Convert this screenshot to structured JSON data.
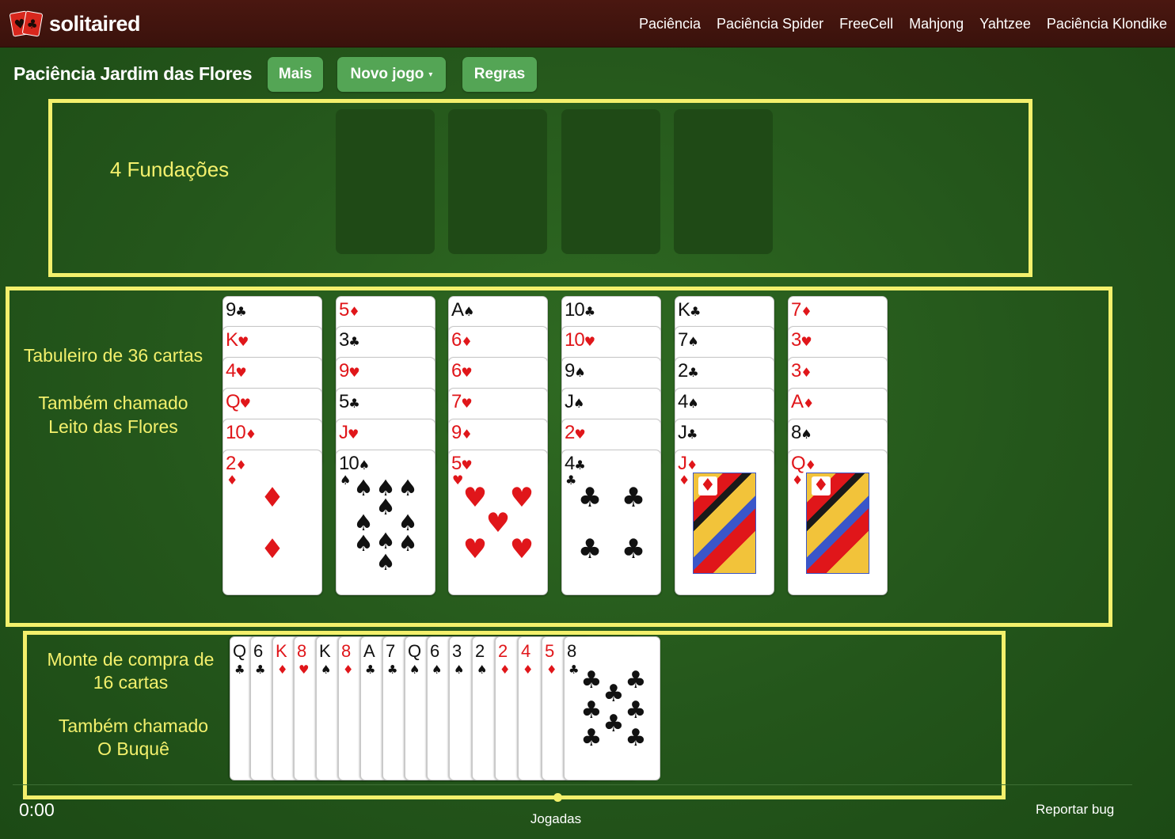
{
  "header": {
    "brand": "solitaired",
    "logo_suits": [
      "♥",
      "♣"
    ],
    "nav": [
      "Paciência",
      "Paciência Spider",
      "FreeCell",
      "Mahjong",
      "Yahtzee",
      "Paciência Klondike"
    ]
  },
  "toolbar": {
    "title": "Paciência Jardim das Flores",
    "more_label": "Mais",
    "new_game_label": "Novo jogo",
    "new_game_caret": "▾",
    "rules_label": "Regras"
  },
  "annotations": {
    "foundations": "4 Fundações",
    "tableau_title": "Tabuleiro de 36 cartas",
    "tableau_alias_1": "Também chamado",
    "tableau_alias_2": "Leito das Flores",
    "stock_title_1": "Monte de compra de",
    "stock_title_2": "16 cartas",
    "stock_alias_1": "Também chamado",
    "stock_alias_2": "O Buquê"
  },
  "foundations": [
    {},
    {},
    {},
    {}
  ],
  "tableau": [
    [
      {
        "rank": "9",
        "suit": "♣"
      },
      {
        "rank": "K",
        "suit": "♥"
      },
      {
        "rank": "4",
        "suit": "♥"
      },
      {
        "rank": "Q",
        "suit": "♥"
      },
      {
        "rank": "10",
        "suit": "♦"
      },
      {
        "rank": "2",
        "suit": "♦"
      }
    ],
    [
      {
        "rank": "5",
        "suit": "♦"
      },
      {
        "rank": "3",
        "suit": "♣"
      },
      {
        "rank": "9",
        "suit": "♥"
      },
      {
        "rank": "5",
        "suit": "♣"
      },
      {
        "rank": "J",
        "suit": "♥"
      },
      {
        "rank": "10",
        "suit": "♠"
      }
    ],
    [
      {
        "rank": "A",
        "suit": "♠"
      },
      {
        "rank": "6",
        "suit": "♦"
      },
      {
        "rank": "6",
        "suit": "♥"
      },
      {
        "rank": "7",
        "suit": "♥"
      },
      {
        "rank": "9",
        "suit": "♦"
      },
      {
        "rank": "5",
        "suit": "♥"
      }
    ],
    [
      {
        "rank": "10",
        "suit": "♣"
      },
      {
        "rank": "10",
        "suit": "♥"
      },
      {
        "rank": "9",
        "suit": "♠"
      },
      {
        "rank": "J",
        "suit": "♠"
      },
      {
        "rank": "2",
        "suit": "♥"
      },
      {
        "rank": "4",
        "suit": "♣"
      }
    ],
    [
      {
        "rank": "K",
        "suit": "♣"
      },
      {
        "rank": "7",
        "suit": "♠"
      },
      {
        "rank": "2",
        "suit": "♣"
      },
      {
        "rank": "4",
        "suit": "♠"
      },
      {
        "rank": "J",
        "suit": "♣"
      },
      {
        "rank": "J",
        "suit": "♦"
      }
    ],
    [
      {
        "rank": "7",
        "suit": "♦"
      },
      {
        "rank": "3",
        "suit": "♥"
      },
      {
        "rank": "3",
        "suit": "♦"
      },
      {
        "rank": "A",
        "suit": "♦"
      },
      {
        "rank": "8",
        "suit": "♠"
      },
      {
        "rank": "Q",
        "suit": "♦"
      }
    ]
  ],
  "stock": [
    {
      "rank": "Q",
      "suit": "♣"
    },
    {
      "rank": "6",
      "suit": "♣"
    },
    {
      "rank": "K",
      "suit": "♦"
    },
    {
      "rank": "8",
      "suit": "♥"
    },
    {
      "rank": "K",
      "suit": "♠"
    },
    {
      "rank": "8",
      "suit": "♦"
    },
    {
      "rank": "A",
      "suit": "♣"
    },
    {
      "rank": "7",
      "suit": "♣"
    },
    {
      "rank": "Q",
      "suit": "♠"
    },
    {
      "rank": "6",
      "suit": "♠"
    },
    {
      "rank": "3",
      "suit": "♠"
    },
    {
      "rank": "2",
      "suit": "♠"
    },
    {
      "rank": "2",
      "suit": "♦"
    },
    {
      "rank": "4",
      "suit": "♦"
    },
    {
      "rank": "5",
      "suit": "♦"
    },
    {
      "rank": "8",
      "suit": "♣"
    }
  ],
  "footer": {
    "timer": "0:00",
    "moves_label": "Jogadas",
    "report_bug": "Reportar bug"
  },
  "colors": {
    "felt": "#24561b",
    "header": "#4a1710",
    "button": "#54a555",
    "annotation": "#f3f06c",
    "red_suit": "#e0161a"
  }
}
